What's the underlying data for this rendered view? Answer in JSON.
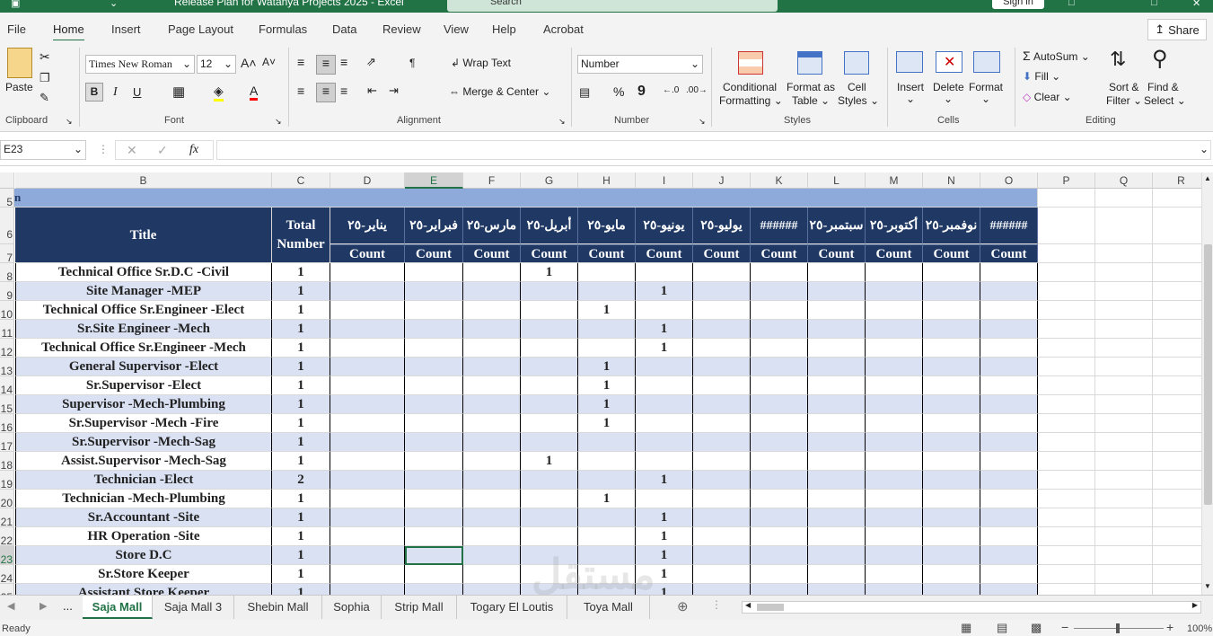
{
  "window": {
    "title": "Release Plan for Watanya Projects 2025 - Excel",
    "search_placeholder": "Search",
    "signin": "Sign in"
  },
  "menu": {
    "tabs": [
      "File",
      "Home",
      "Insert",
      "Page Layout",
      "Formulas",
      "Data",
      "Review",
      "View",
      "Help",
      "Acrobat"
    ],
    "active": "Home",
    "share": "Share"
  },
  "ribbon": {
    "clipboard": {
      "paste": "Paste",
      "label": "Clipboard"
    },
    "font": {
      "name": "Times New Roman",
      "size": "12",
      "label": "Font"
    },
    "alignment": {
      "wrap": "Wrap Text",
      "merge": "Merge & Center",
      "label": "Alignment"
    },
    "number": {
      "format": "Number",
      "label": "Number"
    },
    "styles": {
      "conditional": "Conditional",
      "conditional2": "Formatting",
      "format_table": "Format as",
      "format_table2": "Table",
      "cell_styles": "Cell",
      "cell_styles2": "Styles",
      "label": "Styles"
    },
    "cells": {
      "insert": "Insert",
      "delete": "Delete",
      "format": "Format",
      "label": "Cells"
    },
    "editing": {
      "autosum": "AutoSum",
      "fill": "Fill",
      "clear": "Clear",
      "sort": "Sort &",
      "sort2": "Filter",
      "find": "Find &",
      "find2": "Select",
      "label": "Editing"
    }
  },
  "formula_bar": {
    "name_box": "E23",
    "fx": "fx",
    "value": ""
  },
  "columns": [
    "A",
    "B",
    "C",
    "D",
    "E",
    "F",
    "G",
    "H",
    "I",
    "J",
    "K",
    "L",
    "M",
    "N",
    "O",
    "P",
    "Q",
    "R"
  ],
  "row5_text": "n",
  "header": {
    "title": "Title",
    "total_line1": "Total",
    "total_line2": "Number",
    "months": [
      "يناير-٢٥",
      "فبراير-٢٥",
      "مارس-٢٥",
      "أبريل-٢٥",
      "مايو-٢٥",
      "يونيو-٢٥",
      "يوليو-٢٥",
      "######",
      "سبتمبر-٢٥",
      "أكتوبر-٢٥",
      "نوفمبر-٢٥",
      "######"
    ],
    "count": "Count"
  },
  "rows": [
    {
      "num": "8",
      "title": "Technical Office Sr.D.C -Civil",
      "total": "1",
      "counts": [
        "",
        "",
        "",
        "1",
        "",
        "",
        "",
        "",
        "",
        "",
        "",
        ""
      ]
    },
    {
      "num": "9",
      "title": "Site Manager -MEP",
      "total": "1",
      "counts": [
        "",
        "",
        "",
        "",
        "",
        "1",
        "",
        "",
        "",
        "",
        "",
        ""
      ]
    },
    {
      "num": "10",
      "title": "Technical Office Sr.Engineer -Elect",
      "total": "1",
      "counts": [
        "",
        "",
        "",
        "",
        "1",
        "",
        "",
        "",
        "",
        "",
        "",
        ""
      ]
    },
    {
      "num": "11",
      "title": "Sr.Site Engineer -Mech",
      "total": "1",
      "counts": [
        "",
        "",
        "",
        "",
        "",
        "1",
        "",
        "",
        "",
        "",
        "",
        ""
      ]
    },
    {
      "num": "12",
      "title": "Technical Office Sr.Engineer -Mech",
      "total": "1",
      "counts": [
        "",
        "",
        "",
        "",
        "",
        "1",
        "",
        "",
        "",
        "",
        "",
        ""
      ]
    },
    {
      "num": "13",
      "title": "General Supervisor -Elect",
      "total": "1",
      "counts": [
        "",
        "",
        "",
        "",
        "1",
        "",
        "",
        "",
        "",
        "",
        "",
        ""
      ]
    },
    {
      "num": "14",
      "title": "Sr.Supervisor -Elect",
      "total": "1",
      "counts": [
        "",
        "",
        "",
        "",
        "1",
        "",
        "",
        "",
        "",
        "",
        "",
        ""
      ]
    },
    {
      "num": "15",
      "title": "Supervisor -Mech-Plumbing",
      "total": "1",
      "counts": [
        "",
        "",
        "",
        "",
        "1",
        "",
        "",
        "",
        "",
        "",
        "",
        ""
      ]
    },
    {
      "num": "16",
      "title": "Sr.Supervisor -Mech -Fire",
      "total": "1",
      "counts": [
        "",
        "",
        "",
        "",
        "1",
        "",
        "",
        "",
        "",
        "",
        "",
        ""
      ]
    },
    {
      "num": "17",
      "title": "Sr.Supervisor -Mech-Sag",
      "total": "1",
      "counts": [
        "",
        "",
        "",
        "",
        "",
        "",
        "",
        "",
        "",
        "",
        "",
        ""
      ]
    },
    {
      "num": "18",
      "title": "Assist.Supervisor -Mech-Sag",
      "total": "1",
      "counts": [
        "",
        "",
        "",
        "1",
        "",
        "",
        "",
        "",
        "",
        "",
        "",
        ""
      ]
    },
    {
      "num": "19",
      "title": "Technician -Elect",
      "total": "2",
      "counts": [
        "",
        "",
        "",
        "",
        "",
        "1",
        "",
        "",
        "",
        "",
        "",
        ""
      ]
    },
    {
      "num": "20",
      "title": "Technician -Mech-Plumbing",
      "total": "1",
      "counts": [
        "",
        "",
        "",
        "",
        "1",
        "",
        "",
        "",
        "",
        "",
        "",
        ""
      ]
    },
    {
      "num": "21",
      "title": "Sr.Accountant -Site",
      "total": "1",
      "counts": [
        "",
        "",
        "",
        "",
        "",
        "1",
        "",
        "",
        "",
        "",
        "",
        ""
      ]
    },
    {
      "num": "22",
      "title": "HR Operation -Site",
      "total": "1",
      "counts": [
        "",
        "",
        "",
        "",
        "",
        "1",
        "",
        "",
        "",
        "",
        "",
        ""
      ]
    },
    {
      "num": "23",
      "title": "Store D.C",
      "total": "1",
      "counts": [
        "",
        "",
        "",
        "",
        "",
        "1",
        "",
        "",
        "",
        "",
        "",
        ""
      ]
    },
    {
      "num": "24",
      "title": "Sr.Store Keeper",
      "total": "1",
      "counts": [
        "",
        "",
        "",
        "",
        "",
        "1",
        "",
        "",
        "",
        "",
        "",
        ""
      ]
    },
    {
      "num": "25",
      "title": "Assistant Store Keeper",
      "total": "1",
      "counts": [
        "",
        "",
        "",
        "",
        "",
        "1",
        "",
        "",
        "",
        "",
        "",
        ""
      ]
    }
  ],
  "sheet_tabs": {
    "more": "...",
    "tabs": [
      "Saja Mall",
      "Saja Mall 3",
      "Shebin Mall",
      "Sophia",
      "Strip Mall",
      "Togary El Loutis",
      "Toya Mall"
    ],
    "active": "Saja Mall"
  },
  "status": {
    "ready": "Ready",
    "zoom": "100%"
  },
  "watermark": {
    "arabic": "مستقل",
    "latin": "mostaql.com"
  },
  "colors": {
    "excel_green": "#217346",
    "header_navy": "#1f3864",
    "band_blue": "#8eaadb",
    "row_alt": "#d9e1f2"
  }
}
